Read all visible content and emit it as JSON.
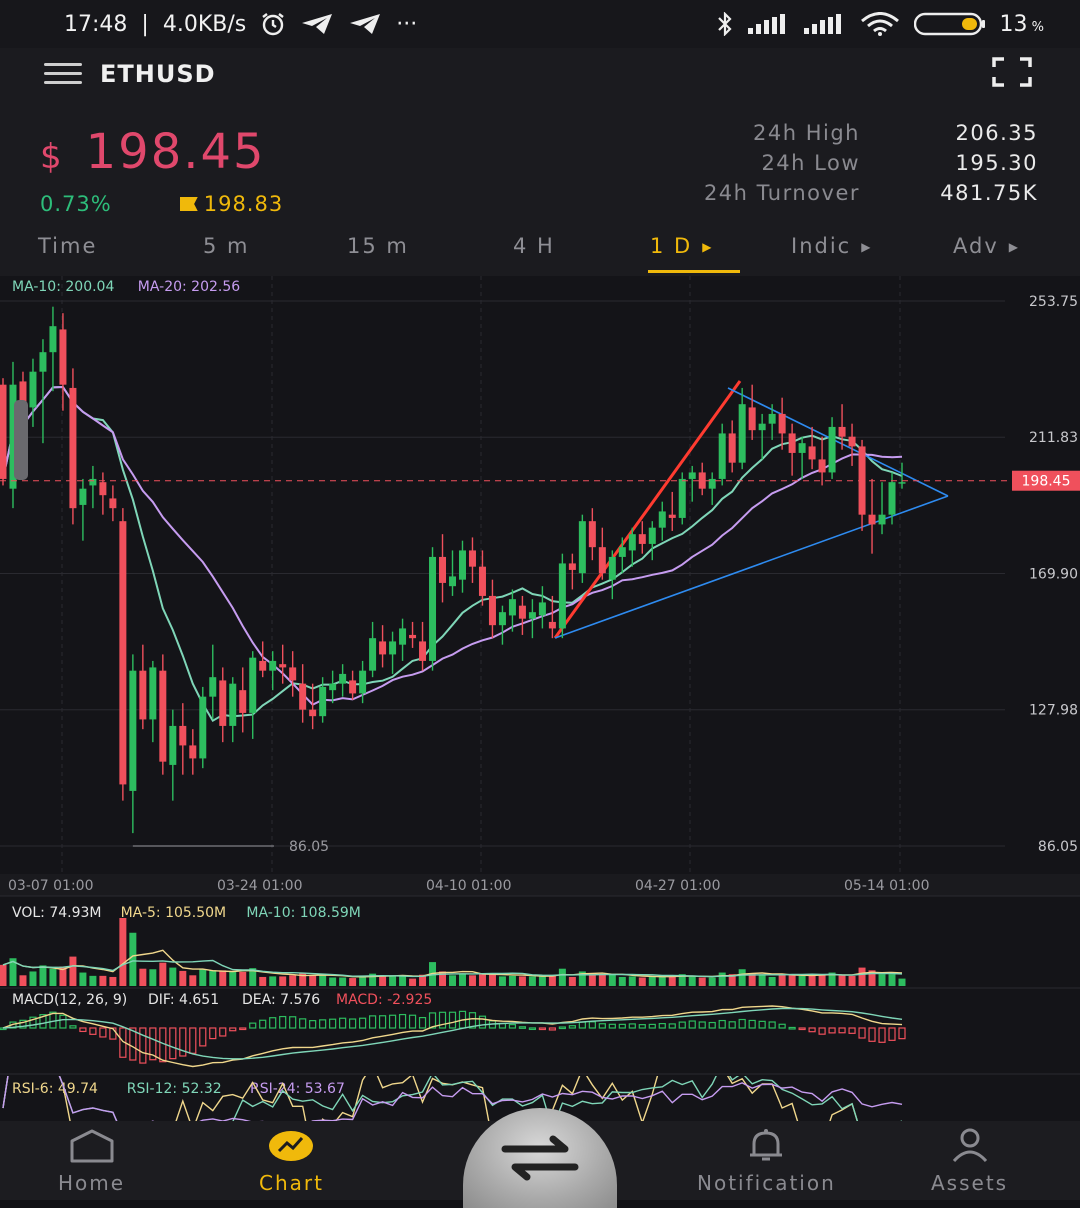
{
  "status_bar": {
    "time": "17:48",
    "net_speed": "4.0KB/s",
    "extra": "···",
    "battery": "13"
  },
  "header": {
    "pair": "ETHUSD"
  },
  "price": {
    "currency": "$",
    "last": "198.45",
    "change_pct": "0.73%",
    "mark_price": "198.83"
  },
  "stats": [
    {
      "label": "24h High",
      "value": "206.35"
    },
    {
      "label": "24h Low",
      "value": "195.30"
    },
    {
      "label": "24h Turnover",
      "value": "481.75K"
    }
  ],
  "tabs": [
    "Time",
    "5 m",
    "15 m",
    "4 H",
    "1 D",
    "Indic",
    "Adv"
  ],
  "active_tab": "1 D",
  "chart_data": {
    "type": "candlestick",
    "main_legend": [
      {
        "text": "MA-10: 200.04",
        "color": "#7fd6b8"
      },
      {
        "text": "MA-20: 202.56",
        "color": "#c69cf0"
      }
    ],
    "y_ticks": [
      "253.75",
      "211.83",
      "169.90",
      "127.98",
      "86.05"
    ],
    "x_ticks": [
      "03-07 01:00",
      "03-24 01:00",
      "04-10 01:00",
      "04-27 01:00",
      "05-14 01:00"
    ],
    "last_price_label": "198.45",
    "min_label": "86.05",
    "up_color": "#2dbd5f",
    "down_color": "#f0505c",
    "candles_ohlc": [
      [
        228,
        230,
        197,
        199
      ],
      [
        196,
        235,
        190,
        228
      ],
      [
        229,
        232,
        218,
        220
      ],
      [
        221,
        236,
        215,
        232
      ],
      [
        232,
        242,
        210,
        238
      ],
      [
        238,
        252,
        226,
        246
      ],
      [
        245,
        250,
        220,
        228
      ],
      [
        227,
        233,
        185,
        190
      ],
      [
        191,
        199,
        180,
        196
      ],
      [
        197,
        203,
        190,
        199
      ],
      [
        198,
        201,
        188,
        194
      ],
      [
        193,
        197,
        186,
        190
      ],
      [
        186,
        190,
        100,
        105
      ],
      [
        103,
        145,
        90,
        140
      ],
      [
        140,
        148,
        122,
        125
      ],
      [
        125,
        143,
        118,
        141
      ],
      [
        140,
        145,
        108,
        112
      ],
      [
        111,
        128,
        100,
        123
      ],
      [
        123,
        130,
        108,
        117
      ],
      [
        117,
        122,
        108,
        113
      ],
      [
        113,
        135,
        110,
        132
      ],
      [
        132,
        148,
        125,
        138
      ],
      [
        137,
        141,
        118,
        123
      ],
      [
        123,
        138,
        118,
        136
      ],
      [
        134,
        141,
        121,
        127
      ],
      [
        127,
        146,
        119,
        144
      ],
      [
        143,
        149,
        138,
        140
      ],
      [
        140,
        146,
        134,
        143
      ],
      [
        142,
        148,
        136,
        141
      ],
      [
        141,
        146,
        132,
        137
      ],
      [
        136,
        142,
        124,
        128
      ],
      [
        128,
        136,
        122,
        126
      ],
      [
        126,
        138,
        124,
        135
      ],
      [
        134,
        140,
        130,
        136
      ],
      [
        136,
        142,
        132,
        139
      ],
      [
        137,
        140,
        131,
        133
      ],
      [
        133,
        143,
        130,
        140
      ],
      [
        140,
        155,
        138,
        150
      ],
      [
        149,
        154,
        141,
        145
      ],
      [
        145,
        152,
        139,
        149
      ],
      [
        148,
        156,
        143,
        153
      ],
      [
        151,
        155,
        147,
        150
      ],
      [
        149,
        155,
        140,
        143
      ],
      [
        143,
        178,
        140,
        175
      ],
      [
        175,
        182,
        161,
        167
      ],
      [
        166,
        177,
        163,
        169
      ],
      [
        168,
        180,
        164,
        177
      ],
      [
        177,
        181,
        167,
        172
      ],
      [
        172,
        177,
        160,
        163
      ],
      [
        163,
        168,
        150,
        154
      ],
      [
        154,
        160,
        148,
        158
      ],
      [
        157,
        165,
        152,
        162
      ],
      [
        160,
        163,
        151,
        156
      ],
      [
        156,
        162,
        150,
        158
      ],
      [
        157,
        166,
        153,
        161
      ],
      [
        155,
        163,
        150,
        153
      ],
      [
        153,
        176,
        150,
        173
      ],
      [
        173,
        176,
        165,
        171
      ],
      [
        170,
        188,
        167,
        186
      ],
      [
        186,
        190,
        174,
        178
      ],
      [
        178,
        184,
        168,
        170
      ],
      [
        168,
        177,
        162,
        175
      ],
      [
        175,
        181,
        170,
        178
      ],
      [
        177,
        184,
        172,
        182
      ],
      [
        182,
        186,
        176,
        179
      ],
      [
        179,
        186,
        174,
        184
      ],
      [
        184,
        192,
        180,
        189
      ],
      [
        188,
        195,
        183,
        187
      ],
      [
        187,
        201,
        185,
        199
      ],
      [
        199,
        203,
        192,
        201
      ],
      [
        201,
        204,
        194,
        196
      ],
      [
        196,
        201,
        191,
        199
      ],
      [
        199,
        216,
        197,
        213
      ],
      [
        213,
        217,
        201,
        204
      ],
      [
        204,
        227,
        202,
        222
      ],
      [
        221,
        228,
        211,
        214
      ],
      [
        214,
        219,
        205,
        216
      ],
      [
        216,
        222,
        211,
        219
      ],
      [
        219,
        224,
        208,
        213
      ],
      [
        213,
        216,
        200,
        207
      ],
      [
        207,
        212,
        199,
        210
      ],
      [
        209,
        215,
        202,
        205
      ],
      [
        205,
        212,
        197,
        201
      ],
      [
        201,
        218,
        199,
        215
      ],
      [
        215,
        222,
        208,
        212
      ],
      [
        212,
        216,
        203,
        209
      ],
      [
        209,
        211,
        183,
        188
      ],
      [
        188,
        199,
        176,
        185
      ],
      [
        185,
        198,
        182,
        188
      ],
      [
        188,
        201,
        185,
        198
      ],
      [
        198,
        204,
        196,
        198
      ]
    ],
    "volume_panel": {
      "legend": [
        {
          "text": "VOL: 74.93M",
          "color": "#e6e6e6"
        },
        {
          "text": "MA-5: 105.50M",
          "color": "#f0d78c"
        },
        {
          "text": "MA-10: 108.59M",
          "color": "#7fd6b8"
        }
      ]
    },
    "macd_panel": {
      "legend": [
        {
          "text": "MACD(12, 26, 9)",
          "color": "#e6e6e6"
        },
        {
          "text": "DIF: 4.651",
          "color": "#e6e6e6"
        },
        {
          "text": "DEA: 7.576",
          "color": "#e6e6e6"
        },
        {
          "text": "MACD: -2.925",
          "color": "#f0505c"
        }
      ]
    },
    "rsi_panel": {
      "legend": [
        {
          "text": "RSI-6: 49.74",
          "color": "#f0d78c"
        },
        {
          "text": "RSI-12: 52.32",
          "color": "#7fd6b8"
        },
        {
          "text": "RSI-24: 53.67",
          "color": "#c69cf0"
        }
      ]
    }
  },
  "bottom_nav": [
    {
      "label": "Home",
      "icon": "home-icon"
    },
    {
      "label": "Chart",
      "icon": "chart-icon"
    },
    {
      "label": "Notification",
      "icon": "bell-icon"
    },
    {
      "label": "Assets",
      "icon": "person-icon"
    }
  ]
}
